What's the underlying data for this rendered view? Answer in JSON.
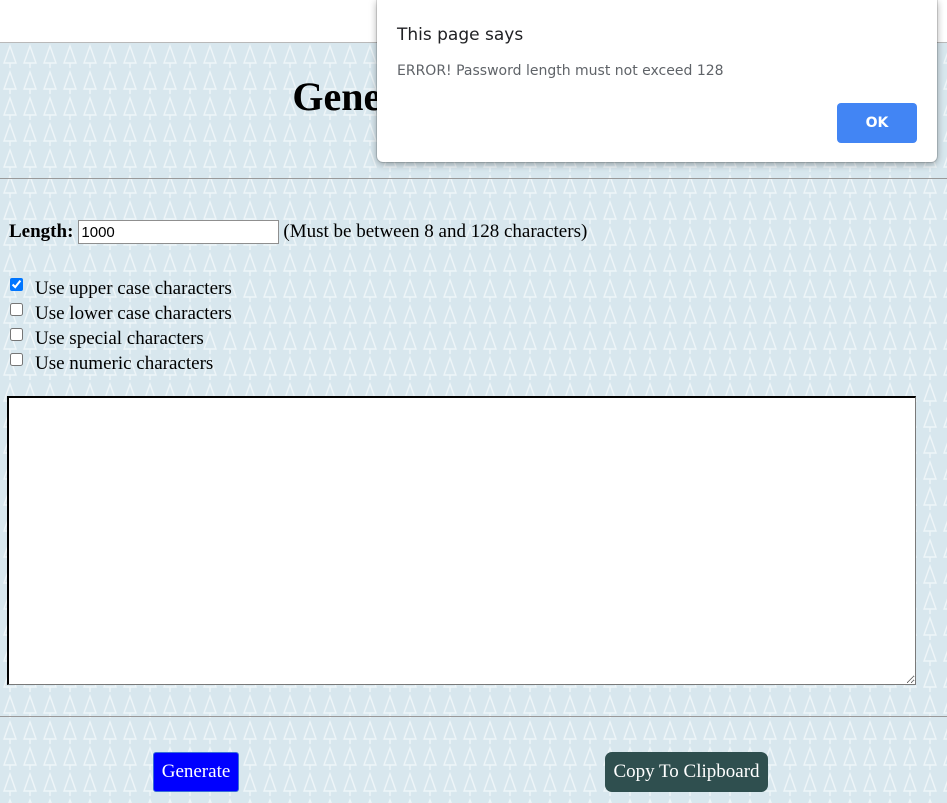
{
  "header": {
    "title": "Generate a Password"
  },
  "length": {
    "label": "Length:",
    "value": "1000",
    "hint": "(Must be between 8 and 128 characters)"
  },
  "options": [
    {
      "label": "Use upper case characters",
      "checked": true
    },
    {
      "label": "Use lower case characters",
      "checked": false
    },
    {
      "label": "Use special characters",
      "checked": false
    },
    {
      "label": "Use numeric characters",
      "checked": false
    }
  ],
  "output": {
    "value": ""
  },
  "buttons": {
    "generate": "Generate",
    "copy": "Copy To Clipboard"
  },
  "dialog": {
    "title": "This page says",
    "message": "ERROR! Password length must not exceed 128",
    "ok": "OK"
  },
  "colors": {
    "background": "#d8e7ee",
    "generate_button": "#0000ff",
    "copy_button": "#2f4f4f",
    "dialog_ok": "#4285f4"
  }
}
